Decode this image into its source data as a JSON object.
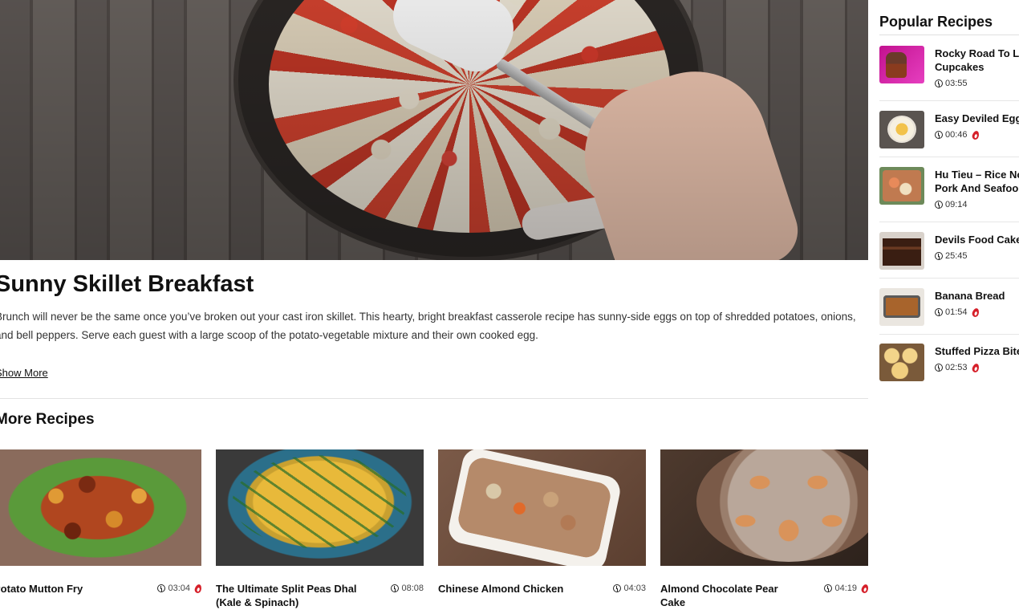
{
  "article": {
    "title": "Sunny Skillet Breakfast",
    "description": "Brunch will never be the same once you’ve broken out your cast iron skillet. This hearty, bright breakfast casserole recipe has sunny-side eggs on top of shredded potatoes, onions, and bell peppers. Serve each guest with a large scoop of the potato-vegetable mixture and their own cooked egg.",
    "show_more_label": "Show More"
  },
  "more_recipes": {
    "heading": "More Recipes",
    "items": [
      {
        "name": "Potato Mutton Fry",
        "duration": "03:04",
        "has_flame": true
      },
      {
        "name": "The Ultimate Split Peas Dhal (Kale & Spinach)",
        "duration": "08:08",
        "has_flame": false
      },
      {
        "name": "Chinese Almond Chicken",
        "duration": "04:03",
        "has_flame": false
      },
      {
        "name": "Almond Chocolate Pear Cake",
        "duration": "04:19",
        "has_flame": true
      }
    ]
  },
  "sidebar": {
    "heading": "Popular Recipes",
    "items": [
      {
        "name": "Rocky Road To L... Cupcakes",
        "line1": "Rocky Road To L",
        "line2": "Cupcakes",
        "duration": "03:55",
        "has_flame": false
      },
      {
        "name": "Easy Deviled Egg",
        "line1": "Easy Deviled Egg",
        "line2": "",
        "duration": "00:46",
        "has_flame": true
      },
      {
        "name": "Hu Tieu – Rice No... Pork And Seafoo",
        "line1": "Hu Tieu – Rice No",
        "line2": "Pork And Seafoo",
        "duration": "09:14",
        "has_flame": false
      },
      {
        "name": "Devils Food Cake",
        "line1": "Devils Food Cake",
        "line2": "",
        "duration": "25:45",
        "has_flame": false
      },
      {
        "name": "Banana Bread",
        "line1": "Banana Bread",
        "line2": "",
        "duration": "01:54",
        "has_flame": true
      },
      {
        "name": "Stuffed Pizza Bite",
        "line1": "Stuffed Pizza Bite",
        "line2": "",
        "duration": "02:53",
        "has_flame": true
      }
    ]
  },
  "icons": {
    "duration": "clock-icon",
    "hot": "flame-icon"
  },
  "colors": {
    "flame": "#d6202a",
    "text": "#111111",
    "divider": "#e3e3e3"
  }
}
